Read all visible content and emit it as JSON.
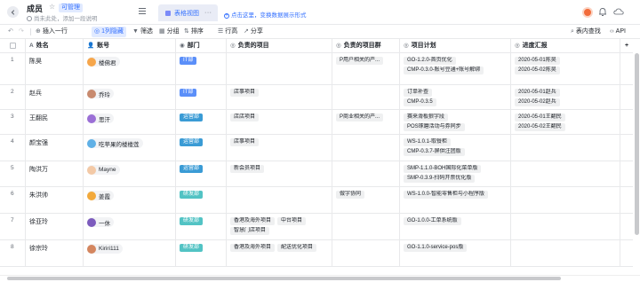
{
  "header": {
    "title": "成员",
    "star_glyph": "☆",
    "permission": "可管理",
    "subtitle": "尚未此处，添加一段说明",
    "view_tab": {
      "label": "表格视图",
      "more": "···"
    },
    "add_view": "点击这里，变换数据展示形式"
  },
  "toolbar": {
    "undo": "↶",
    "redo": "↷",
    "insert": "插入一行",
    "hidden": "1列隐藏",
    "filter": "筛选",
    "group": "分组",
    "sort": "排序",
    "row_height": "行高",
    "share": "分享",
    "search": "表内查找",
    "api": "API"
  },
  "columns": {
    "name": {
      "icon": "A",
      "label": "姓名"
    },
    "account": {
      "icon": "👤",
      "label": "账号"
    },
    "dept": {
      "icon": "◉",
      "label": "部门"
    },
    "owned_projects": {
      "icon": "◎",
      "label": "负责的项目"
    },
    "owned_project_groups": {
      "icon": "◎",
      "label": "负责的项目群"
    },
    "plans": {
      "icon": "◎",
      "label": "项目计划"
    },
    "reports": {
      "icon": "◎",
      "label": "进度汇报"
    },
    "add": "+"
  },
  "colors": {
    "accent": "#3370ff",
    "dept_it": "#5b8ff9",
    "dept_ops": "#3a9bd5",
    "dept_rd": "#52c3c4"
  },
  "rows": [
    {
      "index": "1",
      "name": "陈昊",
      "account": "楼佛君",
      "avatar_color": "#f6a64b",
      "dept": "IT部",
      "dept_color": "#5b8ff9",
      "projects": [],
      "project_groups": [
        "P用户相关的产..."
      ],
      "plans": [
        "GO-1.2.0-首页优化",
        "CMP-0.3.0-账号豆通+账号解绑"
      ],
      "reports": [
        "2020-05-01陈昊",
        "2020-05-02陈昊"
      ]
    },
    {
      "index": "2",
      "name": "赵兵",
      "account": "乔玲",
      "avatar_color": "#c88a6e",
      "dept": "IT部",
      "dept_color": "#5b8ff9",
      "projects": [
        "店事项目"
      ],
      "project_groups": [],
      "plans": [
        "订单补查",
        "CMP-0.3.5"
      ],
      "reports": [
        "2020-05-01赵兵",
        "2020-05-02赵兵"
      ]
    },
    {
      "index": "3",
      "name": "王翻民",
      "account": "思汗",
      "avatar_color": "#9b6fd6",
      "dept": "运营部",
      "dept_color": "#3a9bd5",
      "projects": [
        "店店项目"
      ],
      "project_groups": [
        "P商业相关的产..."
      ],
      "plans": [
        "赛来滑板狼字段",
        "POS琢磨活动与券同步"
      ],
      "reports": [
        "2020-05-01王翻民",
        "2020-05-02王翻民"
      ]
    },
    {
      "index": "4",
      "name": "颜宝强",
      "account": "吃苹果的楼楼莲",
      "avatar_color": "#5fb0e6",
      "dept": "运营部",
      "dept_color": "#3a9bd5",
      "projects": [
        "店事项目"
      ],
      "project_groups": [],
      "plans": [
        "WS-1.0.1-取餐柜",
        "CMP-0.3.7-屏供注团版"
      ],
      "reports": []
    },
    {
      "index": "5",
      "name": "陶洪万",
      "account": "Mayne",
      "avatar_color": "#f3c9a6",
      "dept": "运营部",
      "dept_color": "#3a9bd5",
      "projects": [
        "新会员项目"
      ],
      "project_groups": [],
      "plans": [
        "SMP-1.1.0-BOH国际化菜单版",
        "SMP-0.3.9-扫码开票优化版"
      ],
      "reports": []
    },
    {
      "index": "6",
      "name": "朱洪帅",
      "account": "姜霞",
      "avatar_color": "#f2a93b",
      "dept": "研发部",
      "dept_color": "#52c3c4",
      "projects": [],
      "project_groups": [
        "做字协同"
      ],
      "plans": [
        "WS-1.0.0-智能零售柜与小程序版"
      ],
      "reports": []
    },
    {
      "index": "7",
      "name": "徐亚玲",
      "account": "一休",
      "avatar_color": "#7c5bbd",
      "dept": "研发部",
      "dept_color": "#52c3c4",
      "projects": [
        "香港及海外项目",
        "中台项目",
        "智慧门店项目"
      ],
      "project_groups": [],
      "plans": [
        "GO-1.0.0-工单系统版"
      ],
      "reports": []
    },
    {
      "index": "8",
      "name": "徐宗玲",
      "account": "Kiriri111",
      "avatar_color": "#d4865f",
      "dept": "研发部",
      "dept_color": "#52c3c4",
      "projects": [
        "香港及海外项目",
        "配送优化项目"
      ],
      "project_groups": [],
      "plans": [
        "GO-1.1.0-service-pos版"
      ],
      "reports": []
    }
  ]
}
